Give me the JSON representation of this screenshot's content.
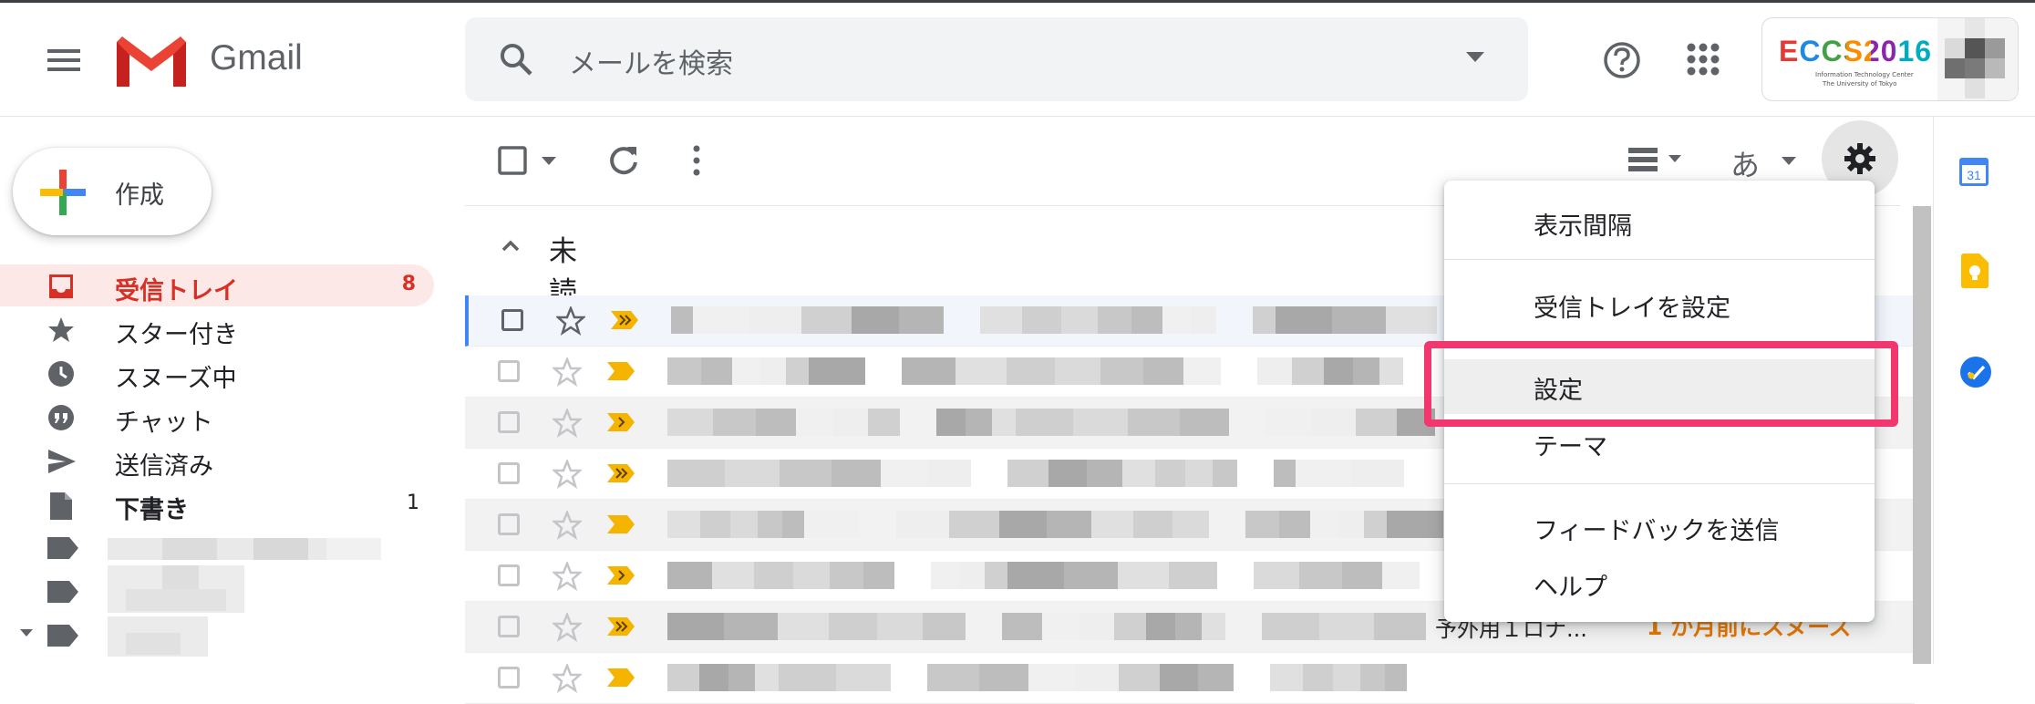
{
  "header": {
    "app_name": "Gmail",
    "search_placeholder": "メールを検索",
    "account_badge": "ECCS2016",
    "account_sub1": "Information Technology Center",
    "account_sub2": "The University of Tokyo"
  },
  "compose": {
    "label": "作成"
  },
  "sidebar": {
    "items": [
      {
        "label": "受信トレイ",
        "count": "8",
        "icon": "inbox-icon"
      },
      {
        "label": "スター付き",
        "count": "",
        "icon": "star-icon"
      },
      {
        "label": "スヌーズ中",
        "count": "",
        "icon": "clock-icon"
      },
      {
        "label": "チャット",
        "count": "",
        "icon": "chat-icon"
      },
      {
        "label": "送信済み",
        "count": "",
        "icon": "send-icon"
      },
      {
        "label": "下書き",
        "count": "1",
        "icon": "draft-icon"
      }
    ]
  },
  "toolbar": {
    "input_tools_label": "あ"
  },
  "section": {
    "label": "未読"
  },
  "settings_menu": {
    "items": [
      {
        "label": "表示間隔"
      },
      {
        "label": "受信トレイを設定"
      },
      {
        "label": "設定"
      },
      {
        "label": "テーマ"
      },
      {
        "label": "フィードバックを送信"
      },
      {
        "label": "ヘルプ"
      }
    ]
  },
  "last_row": {
    "subject_fragment": "予外用１ロナ...",
    "snooze_label": "1 か月前にスヌーズ"
  },
  "colors": {
    "accent_red": "#d93025",
    "highlight_pink": "#f2376e",
    "importance_yellow": "#f4b400"
  }
}
